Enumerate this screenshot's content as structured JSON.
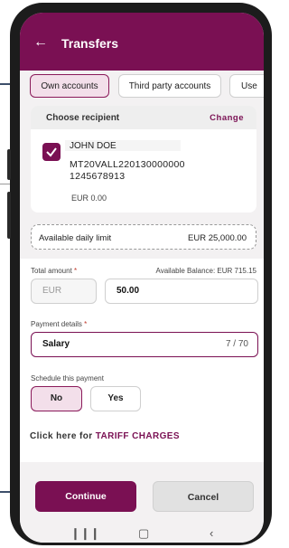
{
  "header": {
    "title": "Transfers"
  },
  "tabs": [
    {
      "label": "Own accounts",
      "active": true
    },
    {
      "label": "Third party accounts",
      "active": false
    },
    {
      "label": "Use",
      "active": false
    }
  ],
  "recipient": {
    "heading": "Choose recipient",
    "change_label": "Change",
    "name": "JOHN DOE",
    "account_line1": "MT20VALL220130000000",
    "account_line2": "1245678913",
    "balance": "EUR 0.00"
  },
  "limit": {
    "label": "Available daily limit",
    "value": "EUR 25,000.00"
  },
  "amount": {
    "label": "Total amount",
    "required_mark": "*",
    "available_balance": "Available Balance: EUR 715.15",
    "currency": "EUR",
    "value": "50.00"
  },
  "payment_details": {
    "label": "Payment details",
    "required_mark": "*",
    "value": "Salary",
    "counter": "7 / 70"
  },
  "schedule": {
    "label": "Schedule this payment",
    "no_label": "No",
    "yes_label": "Yes",
    "selected": "No"
  },
  "tariff": {
    "prefix": "Click here for",
    "link": "TARIFF CHARGES"
  },
  "actions": {
    "continue_label": "Continue",
    "cancel_label": "Cancel"
  },
  "colors": {
    "brand": "#7a1053",
    "selected_bg": "#f3dfea",
    "background": "#f3f1f2"
  },
  "icons": {
    "back": "arrow-left-icon",
    "checkbox": "checkmark-icon",
    "nav_recent": "recent-apps-icon",
    "nav_home": "home-icon",
    "nav_back": "back-chevron-icon"
  }
}
